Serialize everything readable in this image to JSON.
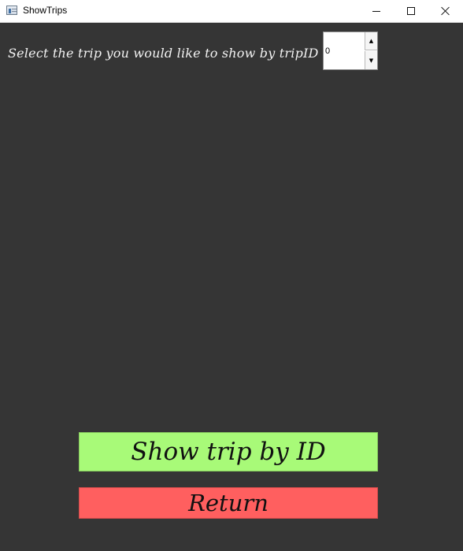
{
  "window": {
    "title": "ShowTrips",
    "controls": {
      "minimize": "minimize-icon",
      "maximize": "maximize-icon",
      "close": "close-icon"
    }
  },
  "main": {
    "prompt": "Select the trip you would like to show by tripID",
    "trip_id_spinbox": {
      "value": "0",
      "up_icon": "up-arrow-icon",
      "down_icon": "down-arrow-icon"
    },
    "show_button_label": "Show trip by ID",
    "return_button_label": "Return"
  },
  "colors": {
    "background": "#353535",
    "show_button": "#a8fa78",
    "return_button": "#ff5f5f"
  }
}
